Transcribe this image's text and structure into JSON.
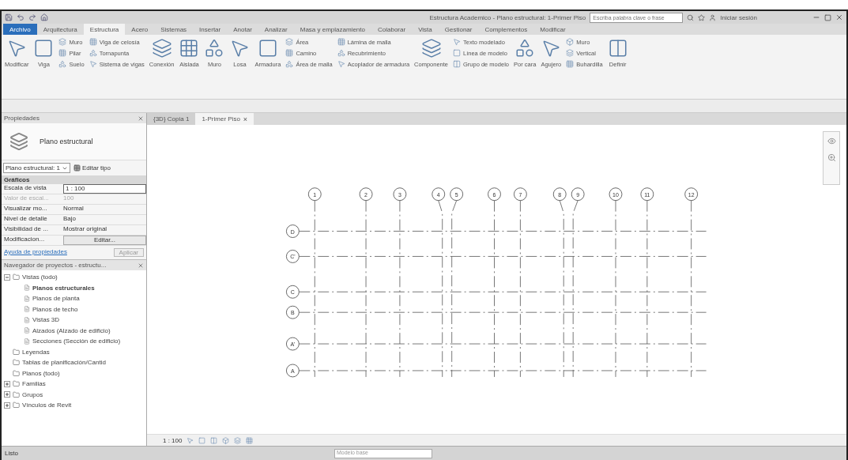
{
  "window": {
    "title": "Estructura Academico - Plano estructural: 1-Primer Piso",
    "search_placeholder": "Escriba palabra clave o frase",
    "user": "Iniciar sesión"
  },
  "ribbon_tabs": [
    {
      "label": "Archivo",
      "kind": "app",
      "selected": false
    },
    {
      "label": "Arquitectura",
      "kind": "tab",
      "selected": false
    },
    {
      "label": "Estructura",
      "kind": "tab",
      "selected": true
    },
    {
      "label": "Acero",
      "kind": "tab",
      "selected": false
    },
    {
      "label": "Sistemas",
      "kind": "tab",
      "selected": false
    },
    {
      "label": "Insertar",
      "kind": "tab",
      "selected": false
    },
    {
      "label": "Anotar",
      "kind": "tab",
      "selected": false
    },
    {
      "label": "Analizar",
      "kind": "tab",
      "selected": false
    },
    {
      "label": "Masa y emplazamiento",
      "kind": "tab",
      "selected": false
    },
    {
      "label": "Colaborar",
      "kind": "tab",
      "selected": false
    },
    {
      "label": "Vista",
      "kind": "tab",
      "selected": false
    },
    {
      "label": "Gestionar",
      "kind": "tab",
      "selected": false
    },
    {
      "label": "Complementos",
      "kind": "tab",
      "selected": false
    },
    {
      "label": "Modificar",
      "kind": "tab",
      "selected": false
    }
  ],
  "ribbon": [
    {
      "kind": "large",
      "label": "Modificar"
    },
    {
      "kind": "large",
      "label": "Viga"
    },
    {
      "kind": "stack",
      "items": [
        "Muro",
        "Pilar",
        "Suelo"
      ]
    },
    {
      "kind": "stack",
      "items": [
        "Viga de celosía",
        "Tornapunta",
        "Sistema de vigas"
      ]
    },
    {
      "kind": "large",
      "label": "Conexión"
    },
    {
      "kind": "large",
      "label": "Aislada"
    },
    {
      "kind": "large",
      "label": "Muro"
    },
    {
      "kind": "large",
      "label": "Losa"
    },
    {
      "kind": "large",
      "label": "Armadura"
    },
    {
      "kind": "stack",
      "items": [
        "Área",
        "Camino",
        "Área de malla"
      ]
    },
    {
      "kind": "stack",
      "items": [
        "Lámina de malla",
        "Recubrimiento",
        "Acoplador de armadura"
      ]
    },
    {
      "kind": "large",
      "label": "Componente"
    },
    {
      "kind": "stack",
      "items": [
        "Texto modelado",
        "Línea de modelo",
        "Grupo de modelo"
      ]
    },
    {
      "kind": "large",
      "label": "Por cara"
    },
    {
      "kind": "large",
      "label": "Agujero"
    },
    {
      "kind": "stack",
      "items": [
        "Muro",
        "Vertical",
        "Buhardilla"
      ]
    },
    {
      "kind": "large",
      "label": "Definir"
    }
  ],
  "properties": {
    "title": "Propiedades",
    "type_name": "Plano estructural",
    "selector": "Plano estructural: 1",
    "edit_type": "Editar tipo",
    "section": "Gráficos",
    "rows": [
      {
        "name": "Escala de vista",
        "value": "1 : 100",
        "kind": "field",
        "disabled": false
      },
      {
        "name": "Valor de escal...",
        "value": "100",
        "kind": "text",
        "disabled": true
      },
      {
        "name": "Visualizar mo...",
        "value": "Normal",
        "kind": "text",
        "disabled": false
      },
      {
        "name": "Nivel de detalle",
        "value": "Bajo",
        "kind": "text",
        "disabled": false
      },
      {
        "name": "Visibilidad de ...",
        "value": "Mostrar original",
        "kind": "text",
        "disabled": false
      },
      {
        "name": "Modificacion...",
        "value": "Editar...",
        "kind": "button",
        "disabled": false
      }
    ],
    "help_link": "Ayuda de propiedades",
    "apply": "Aplicar"
  },
  "browser": {
    "title": "Navegador de proyectos - estructu...",
    "tree": [
      {
        "label": "Vistas (todo)",
        "expanded": true,
        "selected": false,
        "children": [
          {
            "label": "Planos estructurales",
            "selected": true
          },
          {
            "label": "Planos de planta",
            "selected": false
          },
          {
            "label": "Planos de techo",
            "selected": false
          },
          {
            "label": "Vistas 3D",
            "selected": false
          },
          {
            "label": "Alzados (Alzado de edificio)",
            "selected": false
          },
          {
            "label": "Secciones (Sección de edificio)",
            "selected": false
          }
        ]
      },
      {
        "label": "Leyendas",
        "selected": false
      },
      {
        "label": "Tablas de planificación/Cantid",
        "selected": false
      },
      {
        "label": "Planos (todo)",
        "selected": false
      },
      {
        "label": "Familias",
        "expanded": false,
        "selected": false
      },
      {
        "label": "Grupos",
        "expanded": false,
        "selected": false
      },
      {
        "label": "Vínculos de Revit",
        "expanded": false,
        "selected": false
      }
    ]
  },
  "view_tabs": [
    {
      "label": "{3D} Copia 1",
      "selected": false
    },
    {
      "label": "1-Primer Piso",
      "selected": true,
      "close": "×"
    }
  ],
  "grid": {
    "columns": [
      "1",
      "2",
      "3",
      "4",
      "5",
      "6",
      "7",
      "8",
      "9",
      "10",
      "11",
      "12"
    ],
    "rows": [
      "D",
      "C'",
      "C",
      "B",
      "A'",
      "A"
    ]
  },
  "view_bar": {
    "scale": "1 : 100"
  },
  "status_bar": {
    "text": "Listo",
    "model": "Modelo base"
  }
}
